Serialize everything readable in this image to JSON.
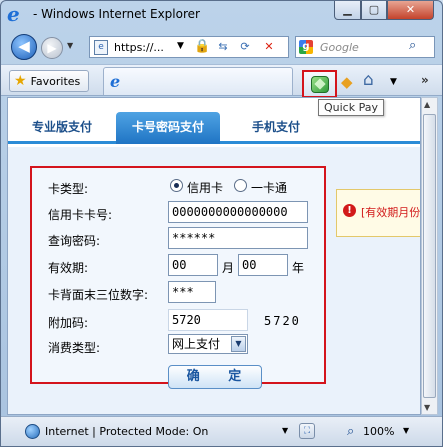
{
  "window": {
    "title": "- Windows Internet Explorer",
    "min_glyph": "▁",
    "max_glyph": "▢",
    "close_glyph": "✕"
  },
  "nav": {
    "back_glyph": "◀",
    "forward_glyph": "▶",
    "dropdown_glyph": "▼",
    "address": "https://...",
    "address_dropdown_glyph": "▼",
    "lock_glyph": "🔒",
    "refresh_glyph": "⟳",
    "compat_glyph": "⇆",
    "stop_glyph": "✕",
    "search_placeholder": "Google",
    "search_glyph": "⌕"
  },
  "favorites_bar": {
    "favorites_label": "Favorites",
    "star_glyph": "★",
    "quick_pay_tooltip": "Quick Pay",
    "feeds_glyph": "◆",
    "home_glyph": "⌂",
    "home_dropdown_glyph": "▼",
    "more_glyph": "»"
  },
  "payment": {
    "tabs": [
      {
        "label": "专业版支付",
        "active": false
      },
      {
        "label": "卡号密码支付",
        "active": true
      },
      {
        "label": "手机支付",
        "active": false
      }
    ],
    "form": {
      "card_type_label": "卡类型:",
      "card_type_options": [
        "信用卡",
        "一卡通"
      ],
      "card_type_selected": "信用卡",
      "card_number_label": "信用卡卡号:",
      "card_number_value": "0000000000000000",
      "query_password_label": "查询密码:",
      "query_password_value": "******",
      "expiry_label": "有效期:",
      "expiry_month_value": "00",
      "month_unit": "月",
      "expiry_year_value": "00",
      "year_unit": "年",
      "cvv_label": "卡背面末三位数字:",
      "cvv_value": "***",
      "extra_code_label": "附加码:",
      "extra_code_value": "5720",
      "extra_code_image": "5720",
      "consumption_type_label": "消费类型:",
      "consumption_type_value": "网上支付",
      "consumption_dropdown_glyph": "▼"
    },
    "confirm_label": "确 定",
    "alert_text": "[有效期月份",
    "alert_glyph": "!"
  },
  "status_bar": {
    "zone_text": "Internet | Protected Mode: On",
    "zone_dropdown_glyph": "▼",
    "zoom_text": "100%",
    "zoom_dropdown_glyph": "▼",
    "zoom_glyph": "⌕"
  },
  "colors": {
    "highlight_border": "#d4141c",
    "active_tab": "#1f74c4",
    "alert_text": "#d21a1a"
  }
}
